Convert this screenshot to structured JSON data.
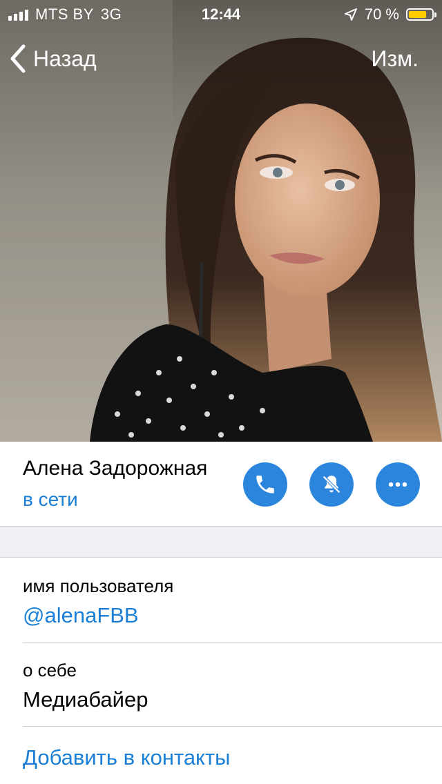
{
  "status_bar": {
    "carrier": "MTS BY",
    "network": "3G",
    "time": "12:44",
    "battery": "70 %",
    "battery_level": 0.7
  },
  "nav": {
    "back_label": "Назад",
    "edit_label": "Изм."
  },
  "profile": {
    "name": "Алена Задорожная",
    "status": "в сети"
  },
  "actions": {
    "icons": [
      "phone-icon",
      "mute-bell-icon",
      "more-dots-icon"
    ],
    "color": "#2b85dd"
  },
  "fields": [
    {
      "label": "имя пользователя",
      "value": "@alenaFBB"
    },
    {
      "label": "о себе",
      "value": "Медиабайер"
    }
  ],
  "add_contact_label": "Добавить в контакты",
  "colors": {
    "accent": "#1b7fd6",
    "battery": "#ffcc00",
    "section_bg": "#efeff4"
  }
}
